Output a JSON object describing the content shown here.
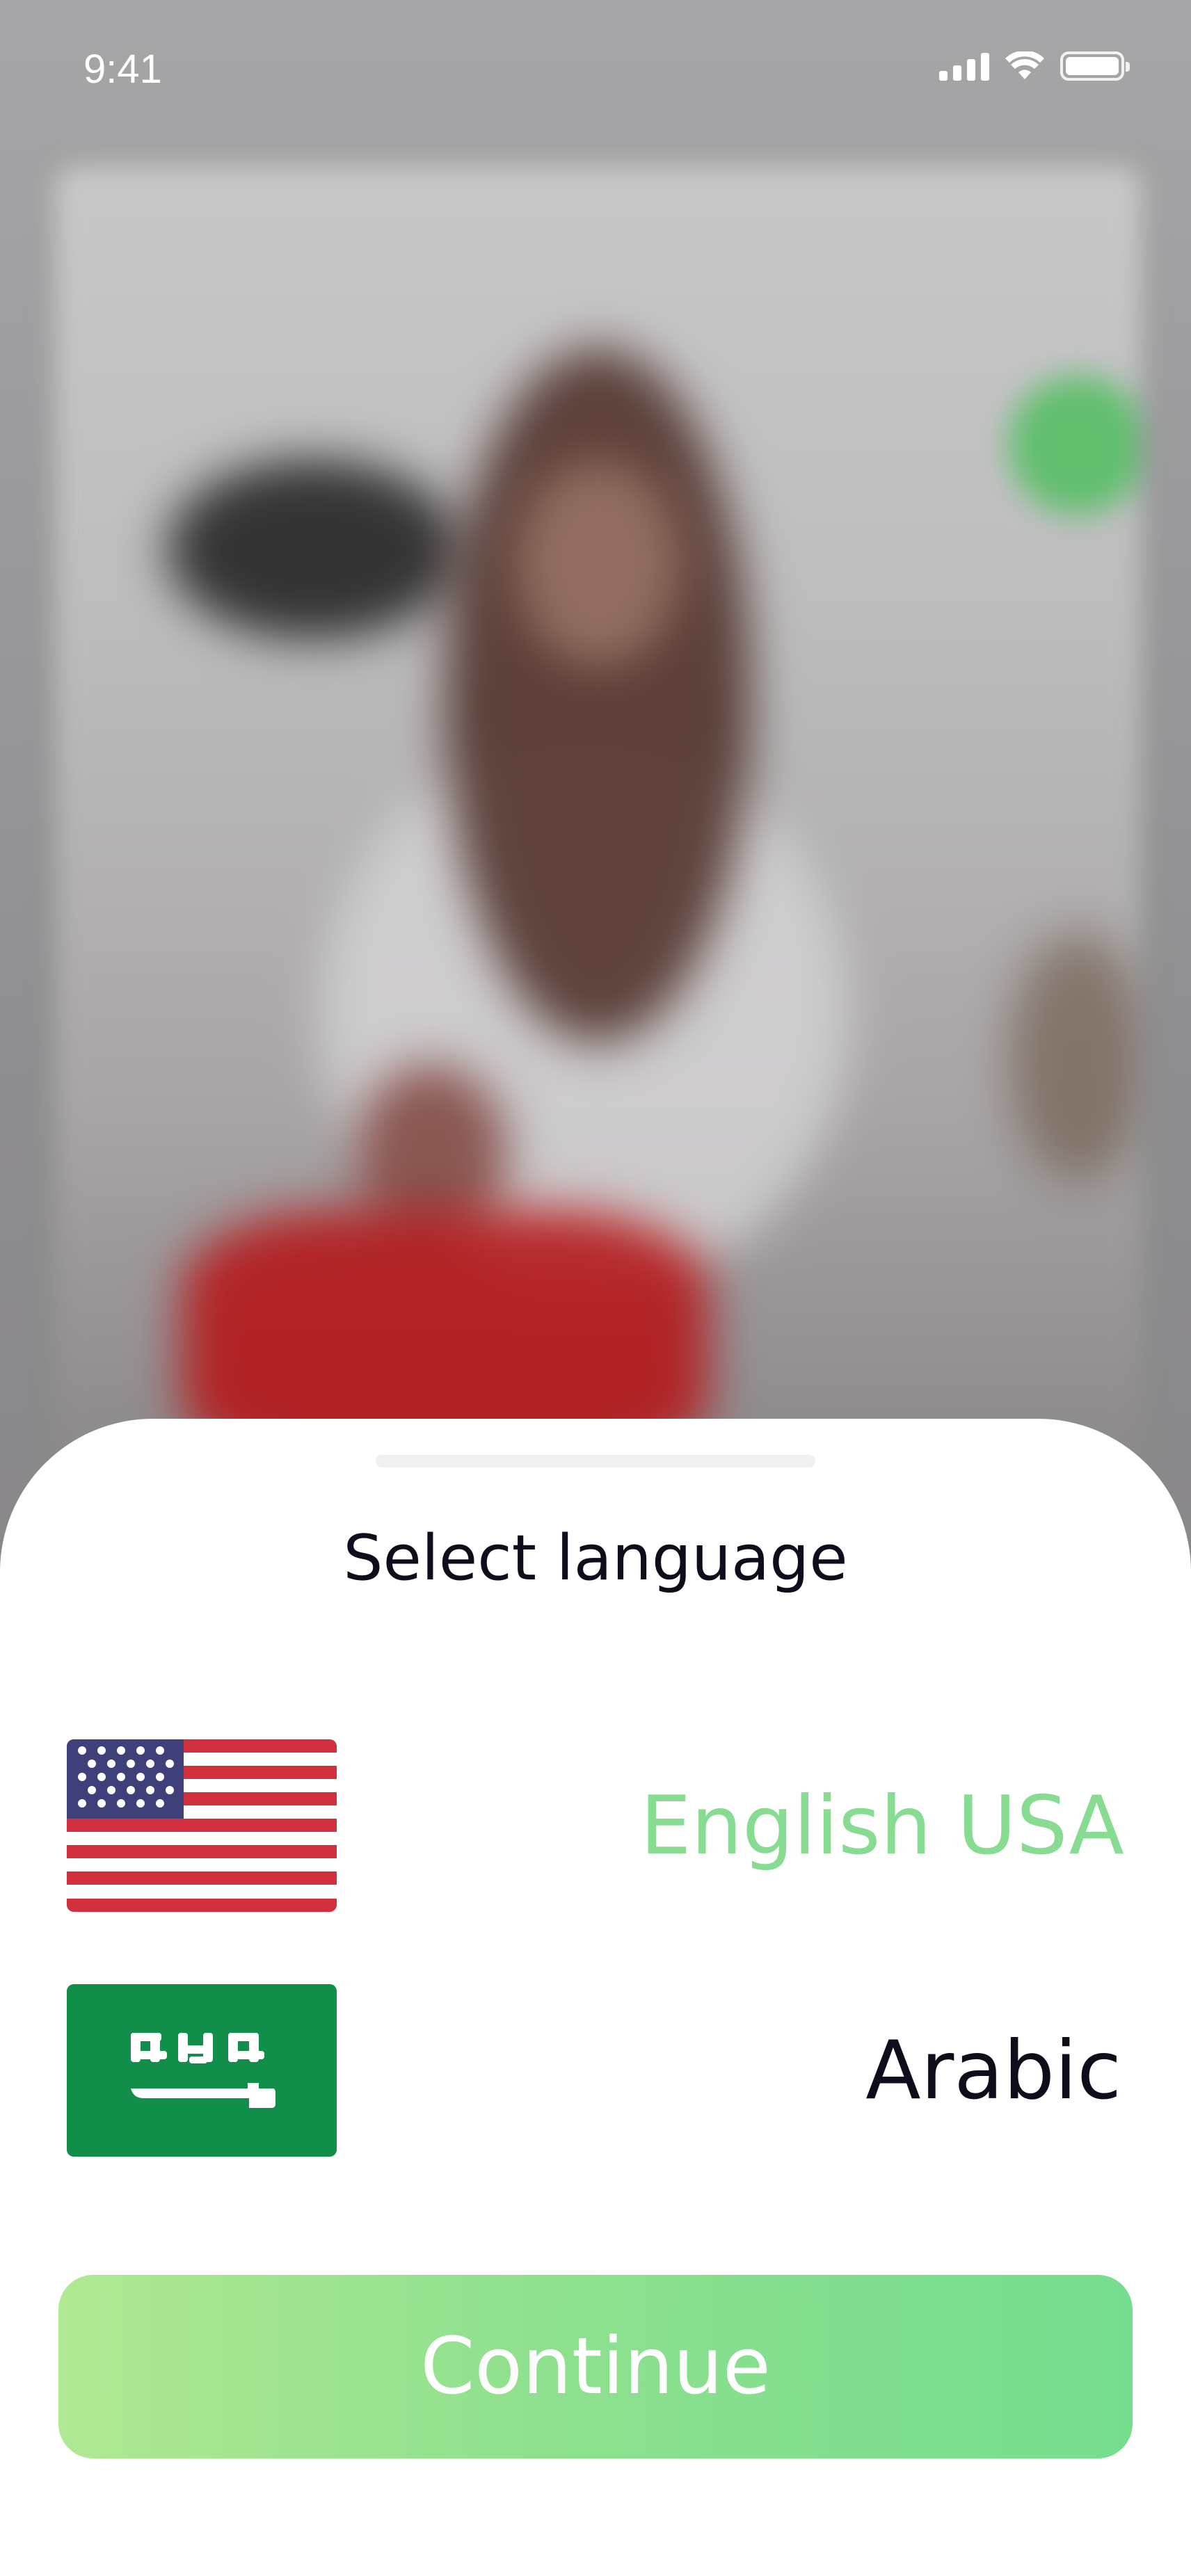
{
  "status_bar": {
    "time": "9:41",
    "icons": [
      "cellular-signal-icon",
      "wifi-icon",
      "battery-icon"
    ]
  },
  "background": {
    "description_icon": "background-photo"
  },
  "sheet": {
    "title": "Select language",
    "languages": [
      {
        "label": "English USA",
        "flag_icon": "us-flag-icon",
        "selected": true,
        "color": "#88dc92"
      },
      {
        "label": "Arabic",
        "flag_icon": "saudi-flag-icon",
        "selected": false,
        "color": "#0d0d1c"
      }
    ],
    "continue_label": "Continue"
  },
  "colors": {
    "accent_green": "#88dc92",
    "button_gradient_start": "#b0e893",
    "button_gradient_end": "#76dd8f",
    "text_dark": "#0d0d1c"
  }
}
